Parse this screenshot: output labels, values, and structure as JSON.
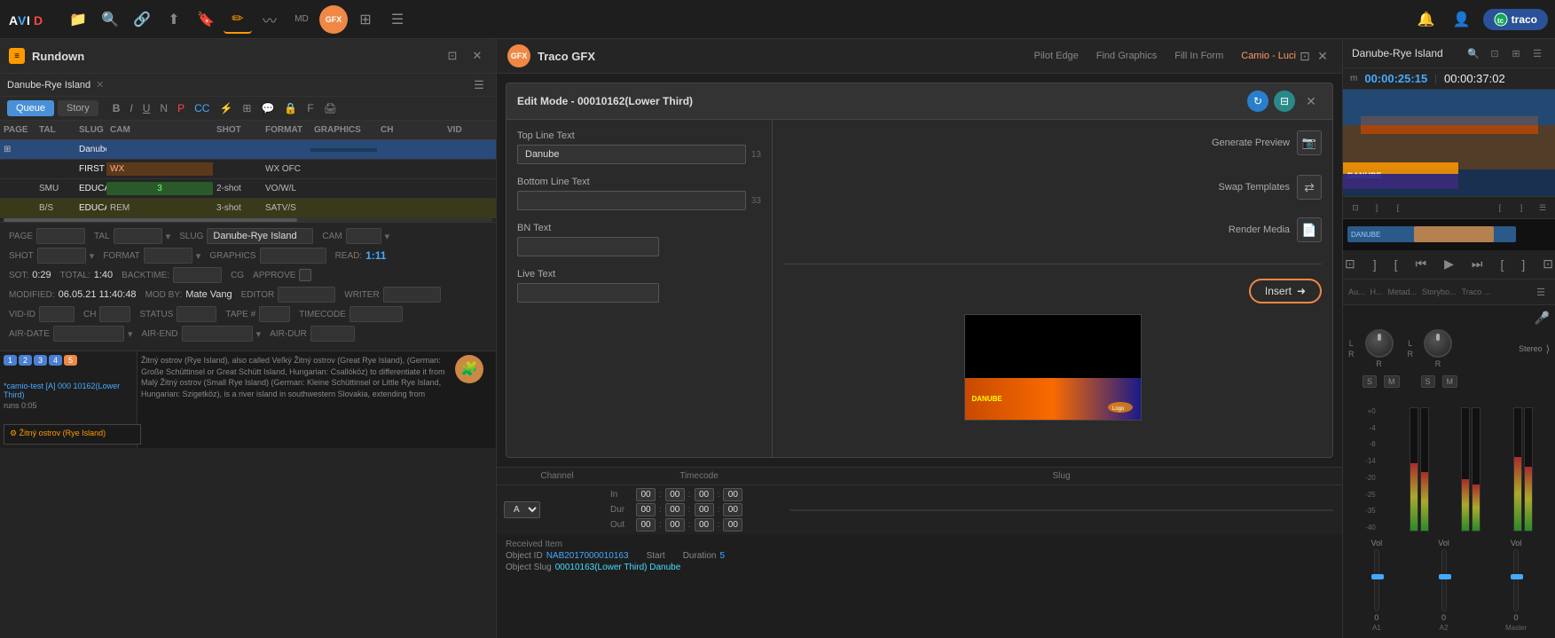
{
  "app": {
    "title": "AVID",
    "traco_label": "traco"
  },
  "nav": {
    "icons": [
      "folder-icon",
      "search-icon",
      "link-icon",
      "upload-icon",
      "bookmark-icon",
      "edit-icon",
      "wave-icon",
      "md-icon",
      "gfx-icon",
      "grid-icon",
      "bars-icon"
    ]
  },
  "left_panel": {
    "title": "Rundown",
    "tab_queue": "Queue",
    "tab_story": "Story",
    "page_tab": "Danube-Rye Island",
    "columns": [
      "PAGE",
      "TAL",
      "SLUG",
      "CAM",
      "SHOT",
      "FORMAT",
      "GRAPHICS",
      "CH",
      "VID"
    ],
    "rows": [
      {
        "page": "",
        "tal": "",
        "slug": "Danube-Rye Island",
        "cam": "",
        "shot": "",
        "format": "",
        "graphics": "",
        "ch": "",
        "vid": "",
        "selected": true,
        "color": "blue"
      },
      {
        "page": "",
        "tal": "",
        "slug": "FIRST WX",
        "cam": "WX",
        "shot": "",
        "format": "WX OFC",
        "graphics": "",
        "ch": "",
        "vid": "",
        "color": ""
      },
      {
        "page": "",
        "tal": "SMU",
        "slug": "EDUCATION SUMMIT",
        "cam": "3",
        "shot": "2-shot",
        "format": "VO/W/L",
        "graphics": "",
        "ch": "",
        "vid": "",
        "color": ""
      },
      {
        "page": "",
        "tal": "B/S",
        "slug": "EDUCATION LIVE",
        "cam": "REM",
        "shot": "3-shot",
        "format": "SATV/S",
        "graphics": "",
        "ch": "",
        "vid": "",
        "color": "yellow"
      }
    ],
    "details": {
      "page_label": "PAGE",
      "tal_label": "TAL",
      "slug_label": "SLUG",
      "slug_value": "Danube-Rye Island",
      "cam_label": "CAM",
      "shot_label": "SHOT",
      "format_label": "FORMAT",
      "graphics_label": "GRAPHICS",
      "read_label": "READ:",
      "read_value": "1:11",
      "sot_label": "SOT:",
      "sot_value": "0:29",
      "total_label": "TOTAL:",
      "total_value": "1:40",
      "backtime_label": "BACKTIME:",
      "cg_label": "CG",
      "approve_label": "APPROVE",
      "modified_label": "MODIFIED:",
      "modified_value": "06.05.21 11:40:48",
      "mod_by_label": "MOD BY:",
      "mod_by_value": "Mate Vang",
      "editor_label": "EDITOR",
      "writer_label": "WRITER",
      "vid_id_label": "VID-ID",
      "ch_label": "CH",
      "status_label": "STATUS",
      "tape_label": "TAPE #",
      "timecode_label": "TIMECODE",
      "air_date_label": "AIR-DATE",
      "air_end_label": "AIR-END",
      "air_dur_label": "AIR-DUR"
    }
  },
  "gfx_panel": {
    "logo_text": "GFX",
    "title": "Traco GFX",
    "nav_pilot": "Pilot Edge",
    "nav_graphics": "Find Graphics",
    "nav_fill": "Fill In Form",
    "nav_camio": "Camio - Luci",
    "edit_dialog": {
      "title": "Edit Mode - 00010162(Lower Third)",
      "top_line_label": "Top Line Text",
      "top_line_value": "Danube",
      "top_line_count": "13",
      "bottom_line_label": "Bottom Line Text",
      "bottom_line_value": "",
      "bottom_line_count": "33",
      "bn_text_label": "BN Text",
      "bn_text_value": "",
      "live_text_label": "Live Text",
      "live_text_value": ""
    },
    "actions": {
      "generate_preview": "Generate Preview",
      "swap_templates": "Swap Templates",
      "render_media": "Render Media",
      "insert": "Insert"
    },
    "timecode": {
      "channel_label": "Channel",
      "timecode_label": "Timecode",
      "slug_label": "Slug",
      "channel_value": "A",
      "in_label": "In",
      "dur_label": "Dur",
      "out_label": "Out",
      "in_values": [
        "00",
        "00",
        "00",
        "00"
      ],
      "dur_values": [
        "00",
        "00",
        "00",
        "00"
      ],
      "out_values": [
        "00",
        "00",
        "00",
        "00"
      ]
    },
    "received_item": {
      "label": "Received Item",
      "object_id_label": "Object ID",
      "object_id_value": "NAB2017000010163",
      "object_slug_label": "Object Slug",
      "object_slug_value": "00010163(Lower Third) Danube",
      "start_label": "Start",
      "start_value": "",
      "duration_label": "Duration",
      "duration_value": "5"
    }
  },
  "right_panel": {
    "title": "Danube-Rye Island",
    "timecode_m": "m",
    "timecode_current": "00:00:25:15",
    "timecode_total": "00:00:37:02",
    "tabs": [
      "Au...",
      "H...",
      "Metad...",
      "Storybo...",
      "Traco ..."
    ],
    "audio": {
      "vol_a1_label": "Vol",
      "vol_a1_value": "0",
      "vol_a2_label": "Vol",
      "vol_a2_value": "0",
      "vol_m_label": "Vol",
      "vol_m_value": "0",
      "stereo_label": "Stereo",
      "channel_labels": [
        "L",
        "R",
        "L",
        "R"
      ],
      "sm_labels": [
        "S",
        "M",
        "S",
        "M"
      ]
    },
    "levels": {
      "db_labels": [
        "+0",
        "-4",
        "-8",
        "-14",
        "-20",
        "-25",
        "-35",
        "-40"
      ]
    }
  },
  "thumb_strip": {
    "badge_numbers": [
      "1",
      "2",
      "3",
      "4",
      "5"
    ],
    "active_badge": "5",
    "title": "*camio-test [A] 000 10162(Lower Third)",
    "subtitle": "runs 0:05",
    "description": "Žitný ostrov (Rye Island), also called Veľký Žitný ostrov (Great Rye Island), (German: Große Schüttinsel or Great Schütt Island, Hungarian: Csallóköz) to differentiate it from Malý Žitný ostrov (Small Rye Island) (German: Kleine Schüttinsel or Little Rye Island, Hungarian: Szigetköz), is a river island in southwestern Slovakia, extending from"
  }
}
